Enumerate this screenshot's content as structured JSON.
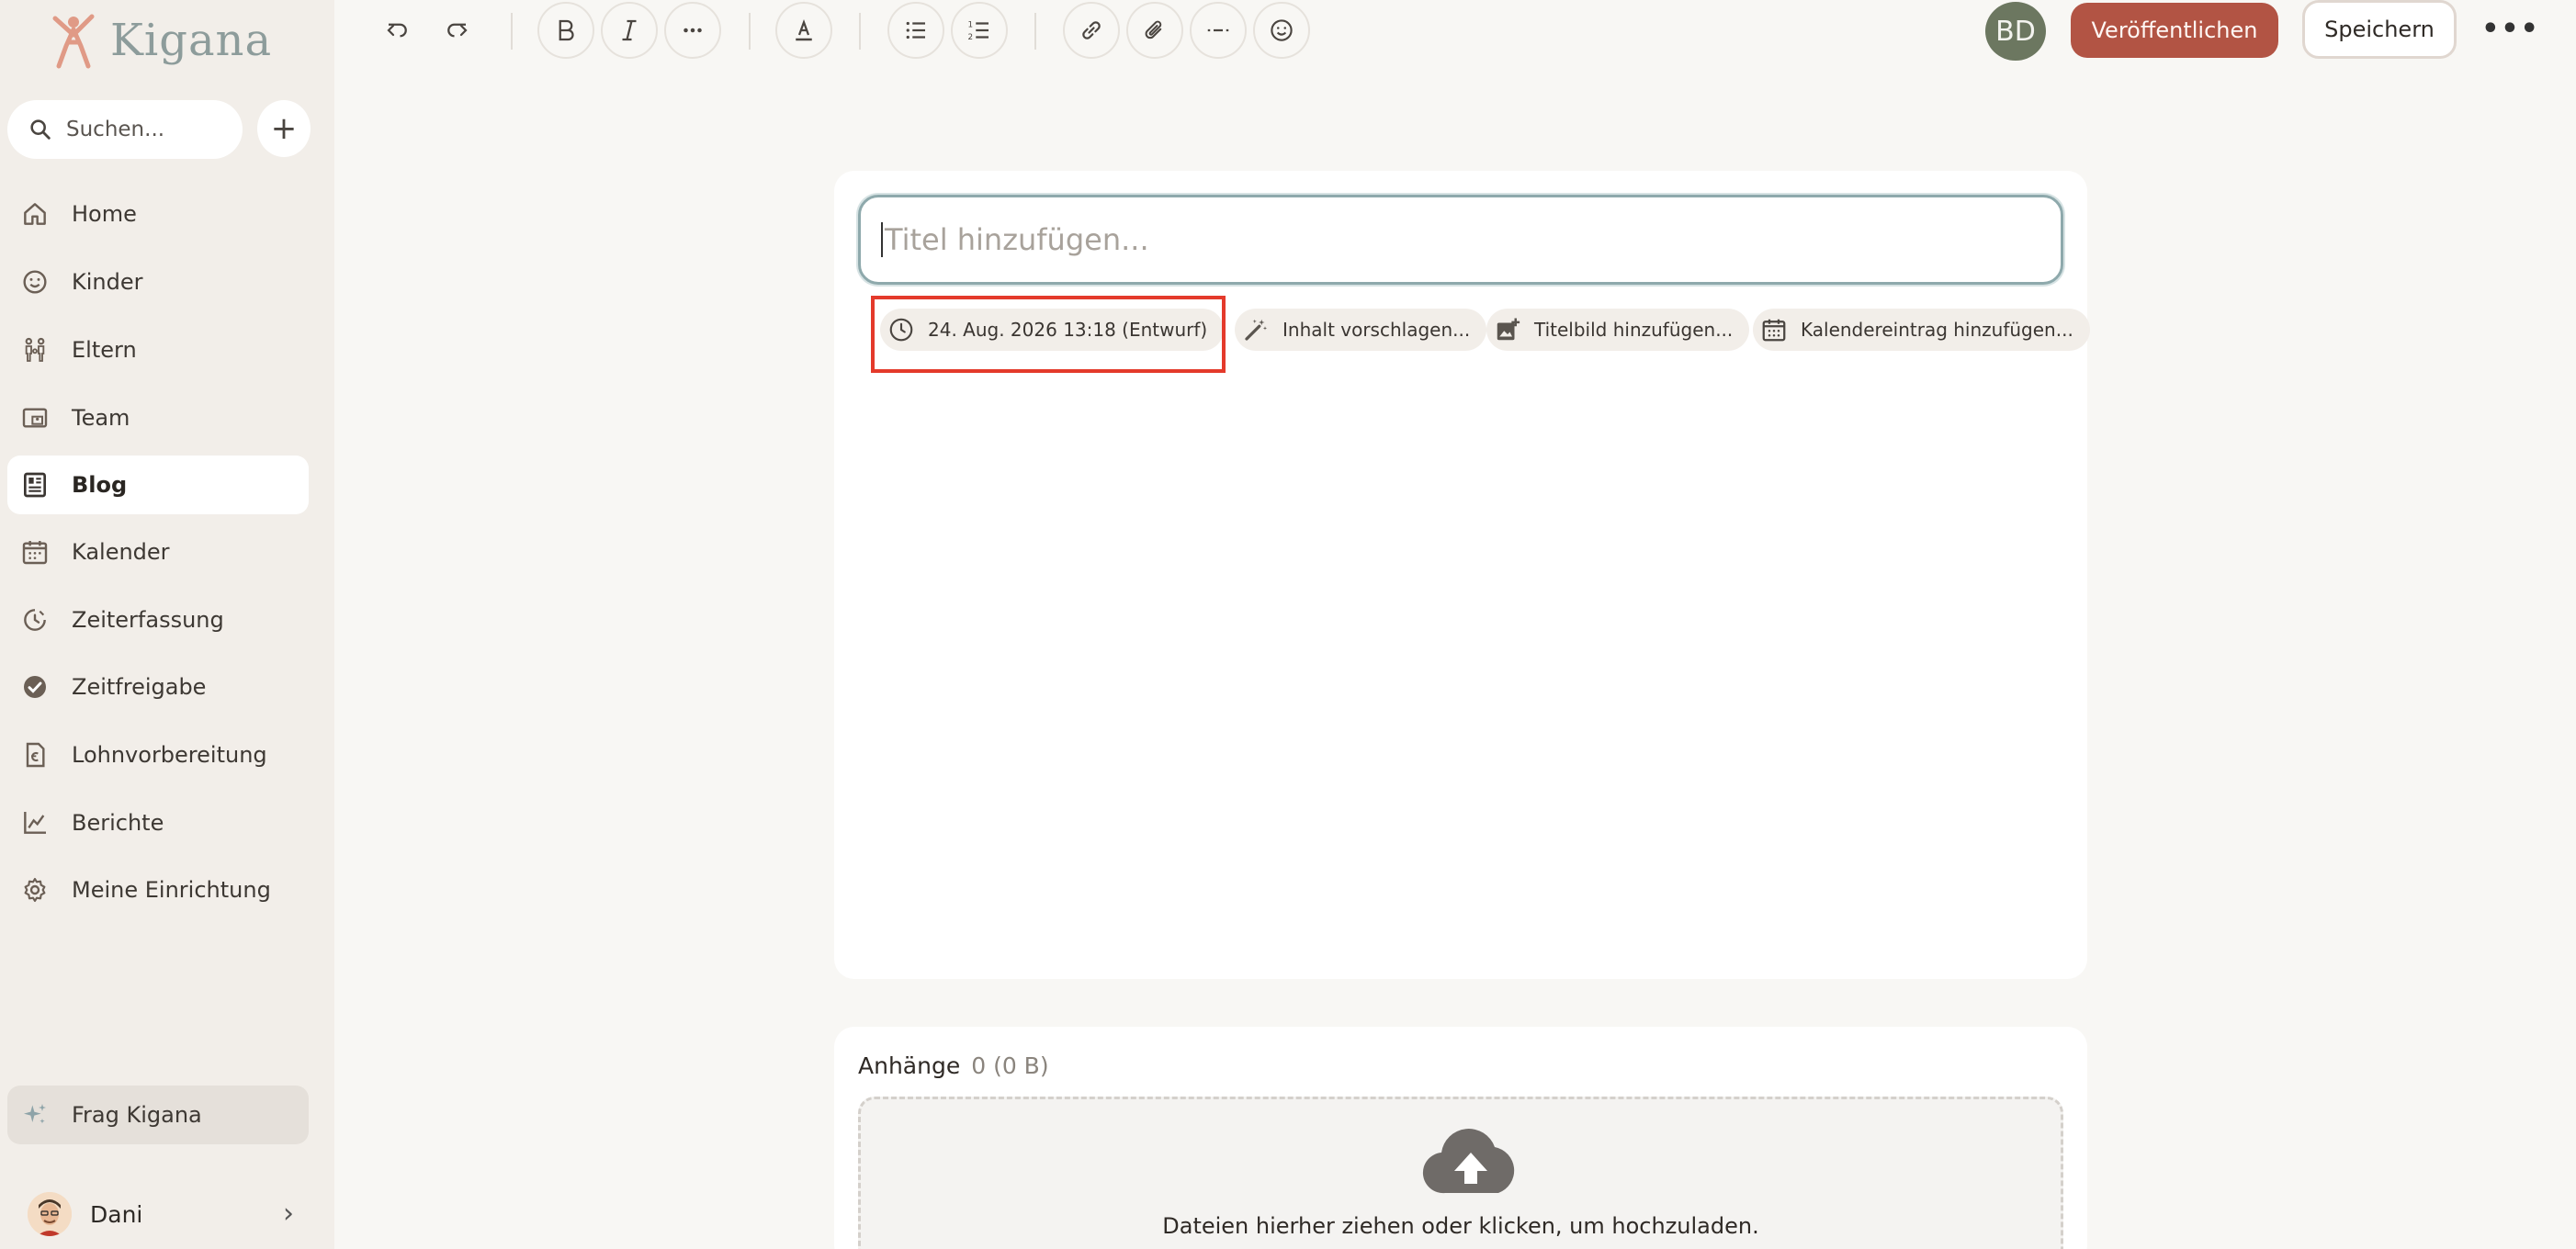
{
  "brand": {
    "name": "Kigana"
  },
  "sidebar": {
    "search_placeholder": "Suchen...",
    "add_label": "+",
    "items": [
      {
        "label": "Home",
        "icon": "home-icon"
      },
      {
        "label": "Kinder",
        "icon": "smiley-icon"
      },
      {
        "label": "Eltern",
        "icon": "family-icon"
      },
      {
        "label": "Team",
        "icon": "id-card-icon"
      },
      {
        "label": "Blog",
        "icon": "article-icon",
        "active": true
      },
      {
        "label": "Kalender",
        "icon": "calendar-icon"
      },
      {
        "label": "Zeiterfassung",
        "icon": "clock-history-icon"
      },
      {
        "label": "Zeitfreigabe",
        "icon": "check-circle-icon"
      },
      {
        "label": "Lohnvorbereitung",
        "icon": "payslip-icon"
      },
      {
        "label": "Berichte",
        "icon": "chart-icon"
      },
      {
        "label": "Meine Einrichtung",
        "icon": "gear-icon"
      }
    ],
    "ask": {
      "label": "Frag Kigana",
      "icon": "sparkle-icon"
    },
    "user": {
      "name": "Dani"
    }
  },
  "toolbar": {
    "avatar_initials": "BD",
    "publish_label": "Veröffentlichen",
    "save_label": "Speichern",
    "more_label": "•••"
  },
  "editor": {
    "title_placeholder": "Titel hinzufügen...",
    "chips": [
      {
        "label": "24. Aug. 2026 13:18 (Entwurf)",
        "icon": "clock-icon"
      },
      {
        "label": "Inhalt vorschlagen...",
        "icon": "magic-wand-icon"
      },
      {
        "label": "Titelbild hinzufügen...",
        "icon": "image-add-icon"
      },
      {
        "label": "Kalendereintrag hinzufügen...",
        "icon": "calendar-icon"
      }
    ]
  },
  "attachments": {
    "title": "Anhänge",
    "count": "0 (0 B)",
    "drop_text": "Dateien hierher ziehen oder klicken, um hochzuladen."
  },
  "colors": {
    "accent": "#b25444",
    "sidebar_bg": "#f2eee9",
    "page_bg": "#f8f7f4",
    "avatar_bg": "#6c7760",
    "highlight": "#e43a2b"
  }
}
